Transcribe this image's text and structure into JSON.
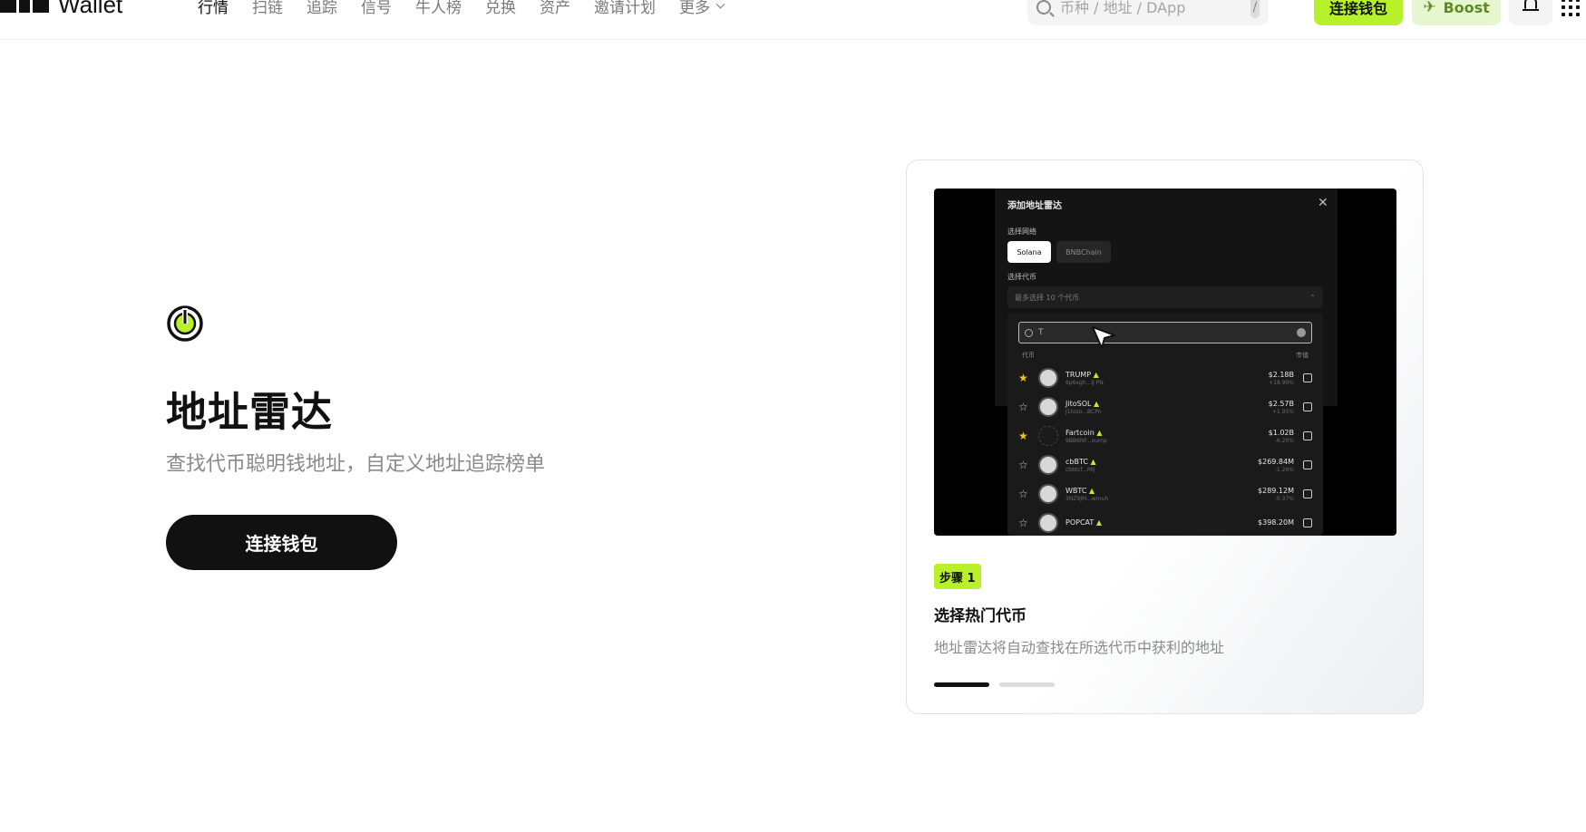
{
  "header": {
    "logo_text": "Wallet",
    "nav": [
      {
        "label": "行情",
        "active": true
      },
      {
        "label": "扫链",
        "active": false
      },
      {
        "label": "追踪",
        "active": false
      },
      {
        "label": "信号",
        "active": false
      },
      {
        "label": "牛人榜",
        "active": false
      },
      {
        "label": "兑换",
        "active": false
      },
      {
        "label": "资产",
        "active": false
      },
      {
        "label": "邀请计划",
        "active": false
      },
      {
        "label": "更多",
        "active": false
      }
    ],
    "search_placeholder": "币种 / 地址 / DApp",
    "search_shortcut": "/",
    "connect_label": "连接钱包",
    "boost_label": "Boost"
  },
  "hero": {
    "title": "地址雷达",
    "subtitle": "查找代币聪明钱地址，自定义地址追踪榜单",
    "cta_label": "连接钱包"
  },
  "card": {
    "step_badge": "步骤 1",
    "step_title": "选择热门代币",
    "step_desc": "地址雷达将自动查找在所选代币中获利的地址",
    "active_step_index": 0,
    "step_count": 2,
    "preview": {
      "modal_title": "添加地址雷达",
      "network_label": "选择网络",
      "networks": [
        "Solana",
        "BNBChain"
      ],
      "token_label": "选择代币",
      "token_placeholder": "最多选择 10 个代币",
      "search_value": "T",
      "col_token": "代币",
      "col_mcap": "市值",
      "rows": [
        {
          "name": "TRUMP",
          "addr": "6p6xgh...iJ PN",
          "mcap": "$2.18B",
          "change": "+18.90%",
          "starred": true
        },
        {
          "name": "JitoSOL",
          "addr": "J1toso...BCPn",
          "mcap": "$2.57B",
          "change": "+1.95%",
          "starred": false
        },
        {
          "name": "Fartcoin",
          "addr": "9BB6NF...oump",
          "mcap": "$1.02B",
          "change": "-6.20%",
          "starred": true
        },
        {
          "name": "cbBTC",
          "addr": "cbbtcf...MiJ",
          "mcap": "$269.84M",
          "change": "-1.26%",
          "starred": false
        },
        {
          "name": "WBTC",
          "addr": "3NZ9JM...wmuh",
          "mcap": "$289.12M",
          "change": "-0.37%",
          "starred": false
        },
        {
          "name": "POPCAT",
          "addr": "",
          "mcap": "$398.20M",
          "change": "",
          "starred": false
        }
      ]
    }
  },
  "colors": {
    "accent": "#b8f12b",
    "text": "#111111",
    "muted": "#8a8a8a"
  }
}
